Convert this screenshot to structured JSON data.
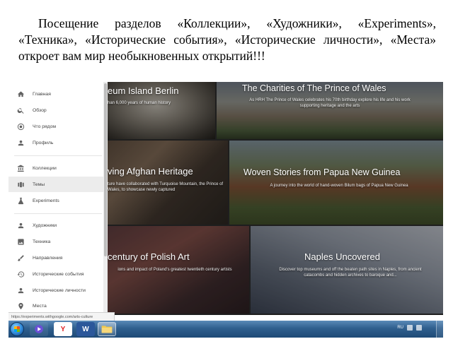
{
  "caption": "Посещение разделов «Коллекции», «Художники», «Experiments», «Техника», «Исторические события», «Исторические личности», «Места» откроет вам мир необыкновенных открытий!!!",
  "sidebar": {
    "items": [
      {
        "label": "Главная",
        "icon": "home-icon"
      },
      {
        "label": "Обзор",
        "icon": "search-icon"
      },
      {
        "label": "Что рядом",
        "icon": "location-icon"
      },
      {
        "label": "Профиль",
        "icon": "person-icon"
      },
      {
        "label": "Коллекции",
        "icon": "museum-icon"
      },
      {
        "label": "Темы",
        "icon": "theme-icon",
        "active": true
      },
      {
        "label": "Experiments",
        "icon": "flask-icon"
      },
      {
        "label": "Художники",
        "icon": "person-icon"
      },
      {
        "label": "Техника",
        "icon": "image-icon"
      },
      {
        "label": "Направления",
        "icon": "brush-icon"
      },
      {
        "label": "Исторические события",
        "icon": "history-icon"
      },
      {
        "label": "Исторические личности",
        "icon": "person-icon"
      },
      {
        "label": "Места",
        "icon": "pin-icon"
      }
    ]
  },
  "tiles": [
    {
      "title": "eum Island Berlin",
      "subtitle": "han 6,000 years of human history"
    },
    {
      "title": "The Charities of The Prince of Wales",
      "subtitle": "As HRH The Prince of Wales celebrates his 70th birthday explore his life and his work supporting heritage and the arts"
    },
    {
      "title": "ving Afghan Heritage",
      "subtitle": "ture have collaborated with Turquoise Mountain, the Prince of Wales, to showcase newly captured"
    },
    {
      "title": "Woven Stories from Papua New Guinea",
      "subtitle": "A journey into the world of hand-woven Bilum bags of Papua New Guinea"
    },
    {
      "title": "century of Polish Art",
      "subtitle": "ions and impact of Poland's greatest twentieth century artists"
    },
    {
      "title": "Naples Uncovered",
      "subtitle": "Discover top museums and off the beaten path sites in Naples, from ancient catacombs and hidden archives to baroque and..."
    }
  ],
  "status_url": "https://experiments.withgoogle.com/arts-culture",
  "taskbar": {
    "apps": [
      {
        "name": "windows-media-player-icon"
      },
      {
        "name": "yandex-browser-icon",
        "label": "Y"
      },
      {
        "name": "word-icon",
        "label": "W"
      },
      {
        "name": "file-explorer-icon"
      }
    ],
    "tray_lang": "RU"
  },
  "colors": {
    "taskbar": "#2f5f8e",
    "active_nav": "#ececec",
    "word_blue": "#2b579a",
    "yandex_red": "#e02020"
  }
}
